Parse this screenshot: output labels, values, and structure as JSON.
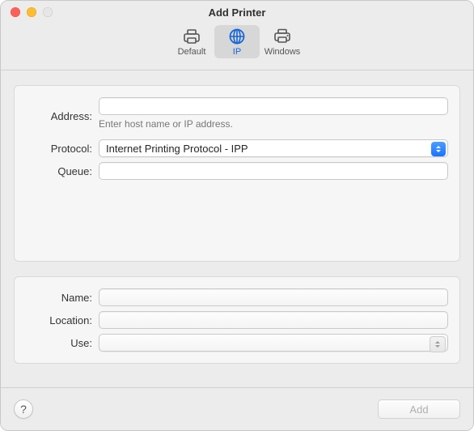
{
  "window": {
    "title": "Add Printer"
  },
  "tabs": {
    "default_label": "Default",
    "ip_label": "IP",
    "windows_label": "Windows",
    "selected": "ip"
  },
  "top": {
    "address_label": "Address:",
    "address_value": "",
    "address_hint": "Enter host name or IP address.",
    "protocol_label": "Protocol:",
    "protocol_value": "Internet Printing Protocol - IPP",
    "queue_label": "Queue:",
    "queue_value": ""
  },
  "bottom": {
    "name_label": "Name:",
    "name_value": "",
    "location_label": "Location:",
    "location_value": "",
    "use_label": "Use:",
    "use_value": ""
  },
  "footer": {
    "help_label": "?",
    "add_label": "Add"
  }
}
